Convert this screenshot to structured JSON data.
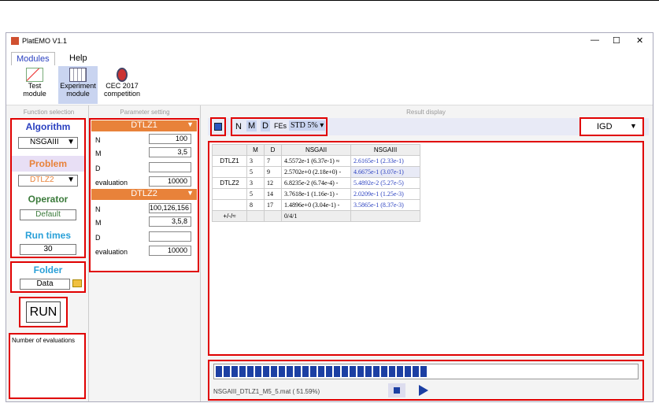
{
  "window": {
    "title": "PlatEMO V1.1",
    "min": "—",
    "max": "☐",
    "close": "✕"
  },
  "menu": {
    "modules": "Modules",
    "help": "Help"
  },
  "ribbon": {
    "test": [
      "Test",
      "module"
    ],
    "experiment": [
      "Experiment",
      "module"
    ],
    "cec": [
      "CEC 2017",
      "competition"
    ]
  },
  "sections": {
    "function": "Function selection",
    "parameter": "Parameter setting",
    "result": "Result display"
  },
  "left": {
    "algorithm_label": "Algorithm",
    "algorithm_value": "NSGAIII",
    "problem_label": "Problem",
    "problem_value": "DTLZ2",
    "operator_label": "Operator",
    "operator_value": "Default",
    "runtimes_label": "Run times",
    "runtimes_value": "30",
    "folder_label": "Folder",
    "folder_value": "Data",
    "run": "RUN",
    "evals_label": "Number of evaluations"
  },
  "params": {
    "p1": {
      "name": "DTLZ1",
      "rows": [
        {
          "k": "N",
          "v": "100"
        },
        {
          "k": "M",
          "v": "3,5"
        },
        {
          "k": "D",
          "v": ""
        },
        {
          "k": "evaluation",
          "v": "10000"
        }
      ]
    },
    "p2": {
      "name": "DTLZ2",
      "rows": [
        {
          "k": "N",
          "v": "100,126,156"
        },
        {
          "k": "M",
          "v": "3,5,8"
        },
        {
          "k": "D",
          "v": ""
        },
        {
          "k": "evaluation",
          "v": "10000"
        }
      ]
    }
  },
  "toolbar": {
    "n": "N",
    "m": "M",
    "d": "D",
    "fes": "FEs",
    "std": "STD 5%",
    "metric": "IGD"
  },
  "table": {
    "headers": [
      "",
      "M",
      "D",
      "NSGAII",
      "NSGAIII"
    ],
    "rows": [
      [
        "DTLZ1",
        "3",
        "7",
        "4.5572e-1 (6.37e-1) ≈",
        "2.6165e-1 (2.33e-1)"
      ],
      [
        "",
        "5",
        "9",
        "2.5702e+0 (2.18e+0) -",
        "4.6675e-1 (3.07e-1)"
      ],
      [
        "DTLZ2",
        "3",
        "12",
        "6.8235e-2 (6.74e-4) -",
        "5.4892e-2 (5.27e-5)"
      ],
      [
        "",
        "5",
        "14",
        "3.7618e-1 (1.16e-1) -",
        "2.0209e-1 (1.25e-3)"
      ],
      [
        "",
        "8",
        "17",
        "1.4896e+0 (3.04e-1) -",
        "3.5865e-1 (8.37e-3)"
      ]
    ],
    "footer": [
      "+/-/≈",
      "",
      "",
      "0/4/1",
      ""
    ]
  },
  "progress": {
    "percent": 51.59,
    "file": "NSGAIII_DTLZ1_M5_5.mat ( 51.59%)"
  },
  "colors": {
    "accent": "#e00000",
    "orange": "#e8823a",
    "blue": "#1c3fa3"
  }
}
